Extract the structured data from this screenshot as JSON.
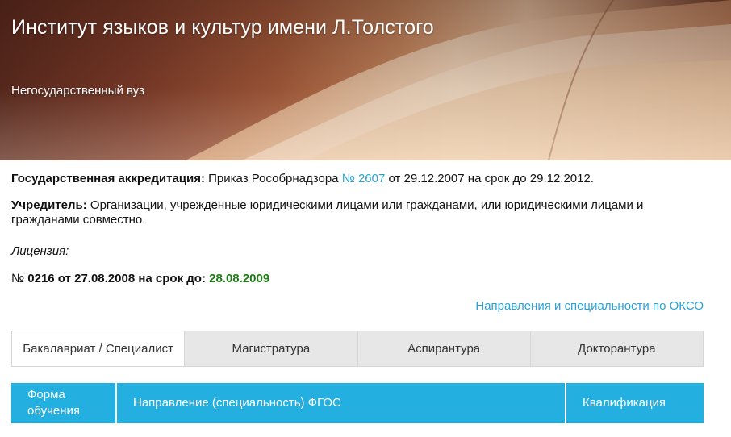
{
  "header": {
    "title": "Институт языков и культур имени Л.Толстого",
    "subtitle": "Негосударственный вуз"
  },
  "accreditation": {
    "label": "Государственная аккредитация:",
    "text_before": " Приказ Рособрнадзора ",
    "link": "№ 2607",
    "text_after": " от 29.12.2007 на срок до 29.12.2012."
  },
  "founder": {
    "label": "Учредитель:",
    "text": " Организации, учрежденные юридическими лицами или гражданами, или юридическими лицами и гражданами совместно."
  },
  "license": {
    "label": "Лицензия:",
    "number_sign": "№",
    "text": " 0216 от 27.08.2008 на срок до: ",
    "expiry": "28.08.2009"
  },
  "okso_link": "Направления и специальности по ОКСО",
  "tabs": [
    {
      "label": "Бакалавриат / Специалист",
      "active": true
    },
    {
      "label": "Магистратура",
      "active": false
    },
    {
      "label": "Аспирантура",
      "active": false
    },
    {
      "label": "Докторантура",
      "active": false
    }
  ],
  "table": {
    "headers": [
      "Форма обучения",
      "Направление (специальность) ФГОС",
      "Квалификация"
    ]
  },
  "colors": {
    "accent": "#23afe0",
    "link": "#2aa2d6",
    "expiry_green": "#1f7a16",
    "tab_inactive": "#e7e7e7"
  }
}
